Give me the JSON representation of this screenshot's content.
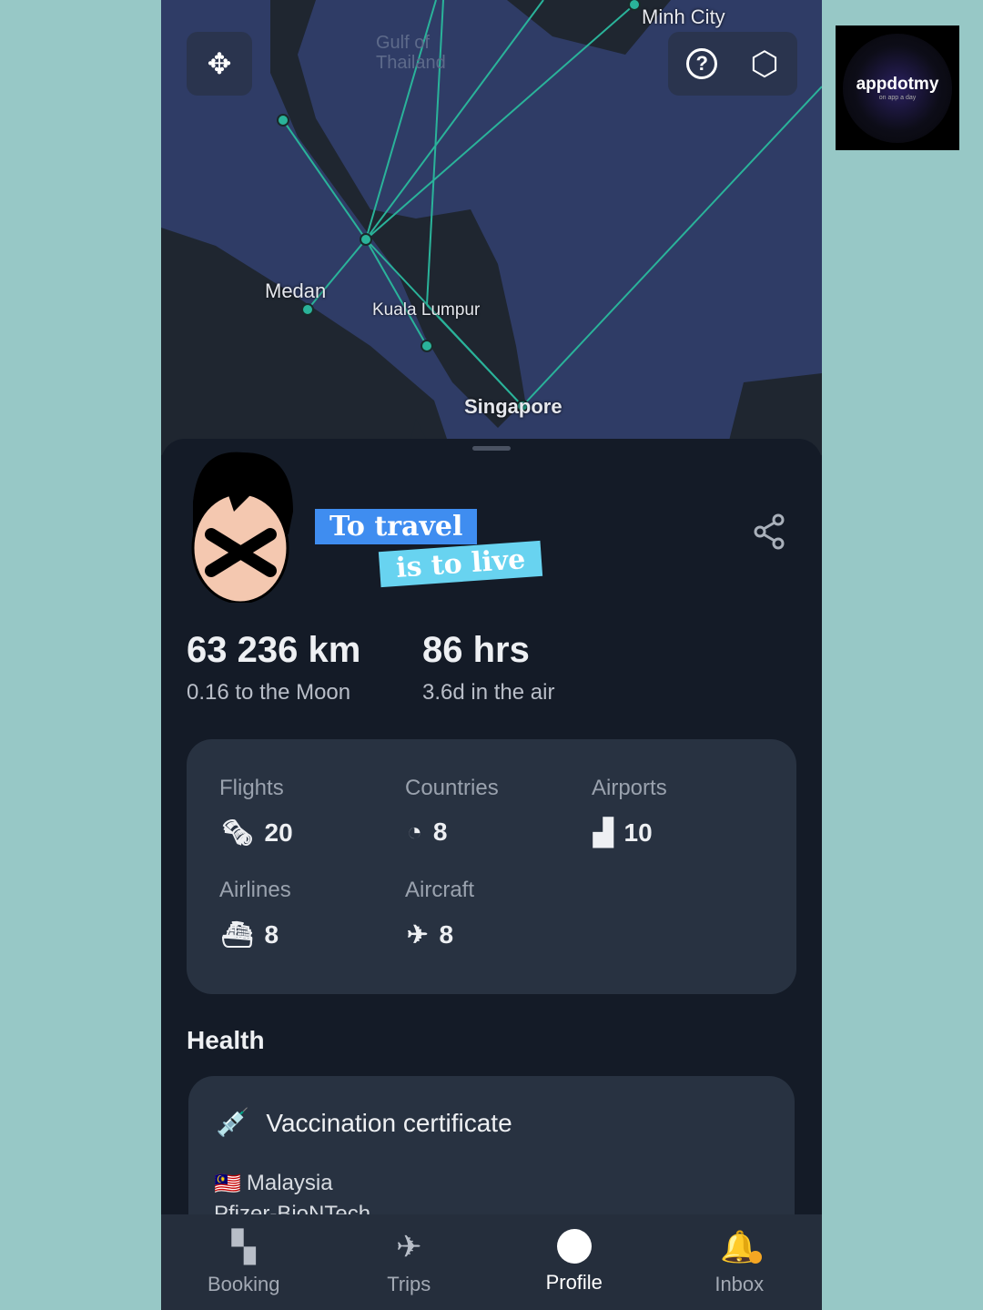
{
  "map": {
    "labels": {
      "hcmc": "Minh City",
      "gulf": "Gulf of Thailand",
      "medan": "Medan",
      "kl": "Kuala Lumpur",
      "singapore": "Singapore"
    },
    "route_color": "#2ab39a"
  },
  "profile": {
    "tagline_1": "To travel",
    "tagline_2": "is to live"
  },
  "stats": {
    "distance": "63 236 km",
    "distance_sub": "0.16 to the Moon",
    "time": "86 hrs",
    "time_sub": "3.6d in the air"
  },
  "summary": [
    {
      "label": "Flights",
      "value": "20",
      "icon": "ticket-icon"
    },
    {
      "label": "Countries",
      "value": "8",
      "icon": "globe-pin-icon"
    },
    {
      "label": "Airports",
      "value": "10",
      "icon": "airport-icon"
    },
    {
      "label": "Airlines",
      "value": "8",
      "icon": "airline-icon"
    },
    {
      "label": "Aircraft",
      "value": "8",
      "icon": "plane-icon"
    }
  ],
  "health": {
    "title": "Health",
    "card_title": "Vaccination certificate",
    "country": "Malaysia",
    "flag": "🇲🇾",
    "vaccine": "Pfizer-BioNTech"
  },
  "nav": [
    {
      "label": "Booking"
    },
    {
      "label": "Trips"
    },
    {
      "label": "Profile",
      "active": true
    },
    {
      "label": "Inbox",
      "badge": true
    }
  ],
  "watermark": {
    "name": "appdotmy",
    "tag": "on app a day"
  },
  "colors": {
    "accent": "#2ab39a",
    "tag_blue": "#3f8df0",
    "tag_cyan": "#68d3f0",
    "badge": "#f5a623"
  }
}
